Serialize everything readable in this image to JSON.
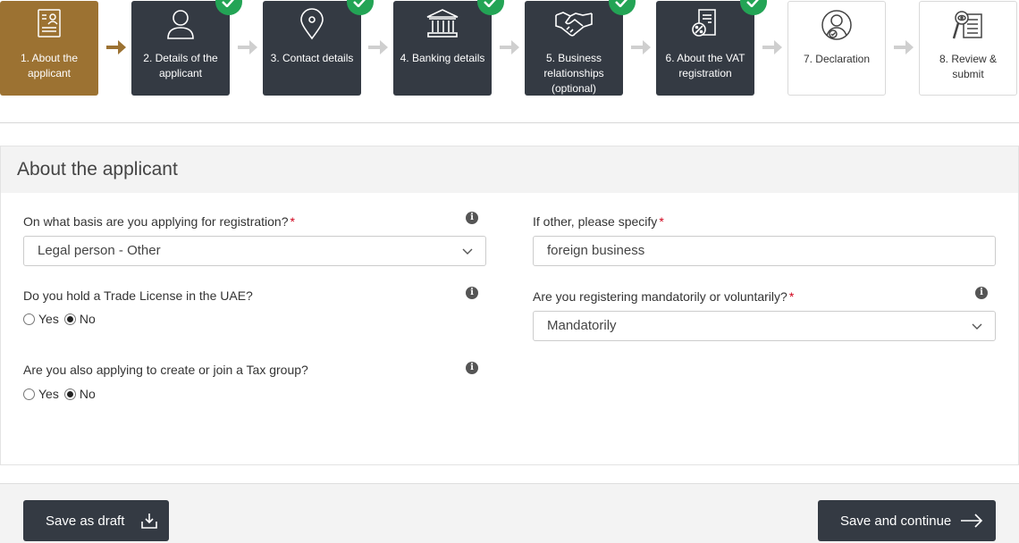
{
  "steps": [
    {
      "label": "1. About the applicant",
      "status": "active",
      "icon": "document-person-icon"
    },
    {
      "label": "2. Details of the applicant",
      "status": "done",
      "icon": "person-icon"
    },
    {
      "label": "3. Contact details",
      "status": "done",
      "icon": "location-pin-icon"
    },
    {
      "label": "4. Banking details",
      "status": "done",
      "icon": "bank-icon"
    },
    {
      "label": "5. Business relationships (optional)",
      "status": "done",
      "icon": "handshake-icon"
    },
    {
      "label": "6. About the VAT registration",
      "status": "done",
      "icon": "vat-document-icon"
    },
    {
      "label": "7. Declaration",
      "status": "todo",
      "icon": "person-check-icon"
    },
    {
      "label": "8. Review & submit",
      "status": "todo",
      "icon": "review-document-icon"
    }
  ],
  "colors": {
    "active": "#9c7232",
    "done": "#343a43",
    "check": "#23a455",
    "required": "#d0021b"
  },
  "panel": {
    "title": "About the applicant",
    "basis": {
      "label": "On what basis are you applying for registration?",
      "required": "*",
      "value": "Legal person - Other"
    },
    "other": {
      "label": "If other, please specify",
      "required": "*",
      "value": "foreign business"
    },
    "trade_license": {
      "label": "Do you hold a Trade License in the UAE?",
      "yes": "Yes",
      "no": "No",
      "selected": "No"
    },
    "registering": {
      "label": "Are you registering mandatorily or voluntarily?",
      "required": "*",
      "value": "Mandatorily"
    },
    "tax_group": {
      "label": "Are you also applying to create or join a Tax group?",
      "yes": "Yes",
      "no": "No",
      "selected": "No"
    }
  },
  "footer": {
    "save_draft": "Save as draft",
    "save_continue": "Save and continue"
  }
}
